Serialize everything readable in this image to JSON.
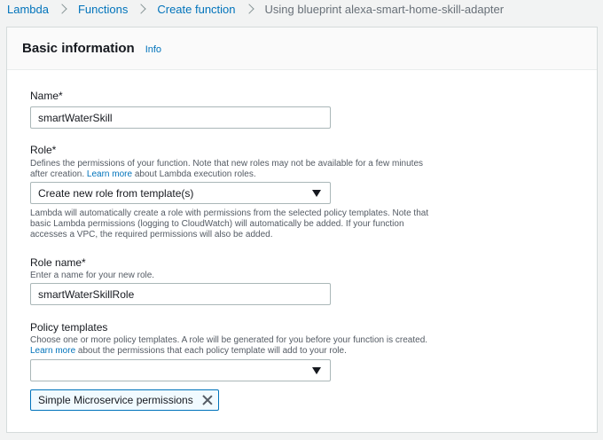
{
  "breadcrumb": {
    "items": [
      "Lambda",
      "Functions",
      "Create function"
    ],
    "current": "Using blueprint alexa-smart-home-skill-adapter"
  },
  "panel": {
    "title": "Basic information",
    "info": "Info"
  },
  "name_field": {
    "label": "Name*",
    "value": "smartWaterSkill"
  },
  "role_field": {
    "label": "Role*",
    "desc_line1": "Defines the permissions of your function. Note that new roles may not be available for a few minutes",
    "desc_line2_pre": "after creation. ",
    "desc_link": "Learn more",
    "desc_line2_post": " about Lambda execution roles.",
    "selected": "Create new role from template(s)",
    "note_line1": "Lambda will automatically create a role with permissions from the selected policy templates. Note that",
    "note_line2": "basic Lambda permissions (logging to CloudWatch) will automatically be added. If your function",
    "note_line3": "accesses a VPC, the required permissions will also be added."
  },
  "role_name_field": {
    "label": "Role name*",
    "desc": "Enter a name for your new role.",
    "value": "smartWaterSkillRole"
  },
  "policy_field": {
    "label": "Policy templates",
    "desc_line1": "Choose one or more policy templates. A role will be generated for you before your function is created.",
    "desc_link": "Learn more",
    "desc_line2_post": " about the permissions that each policy template will add to your role.",
    "selected": "",
    "token": "Simple Microservice permissions"
  },
  "colors": {
    "link": "#0073bb",
    "background": "#f2f3f3",
    "border": "#aab7b8"
  }
}
